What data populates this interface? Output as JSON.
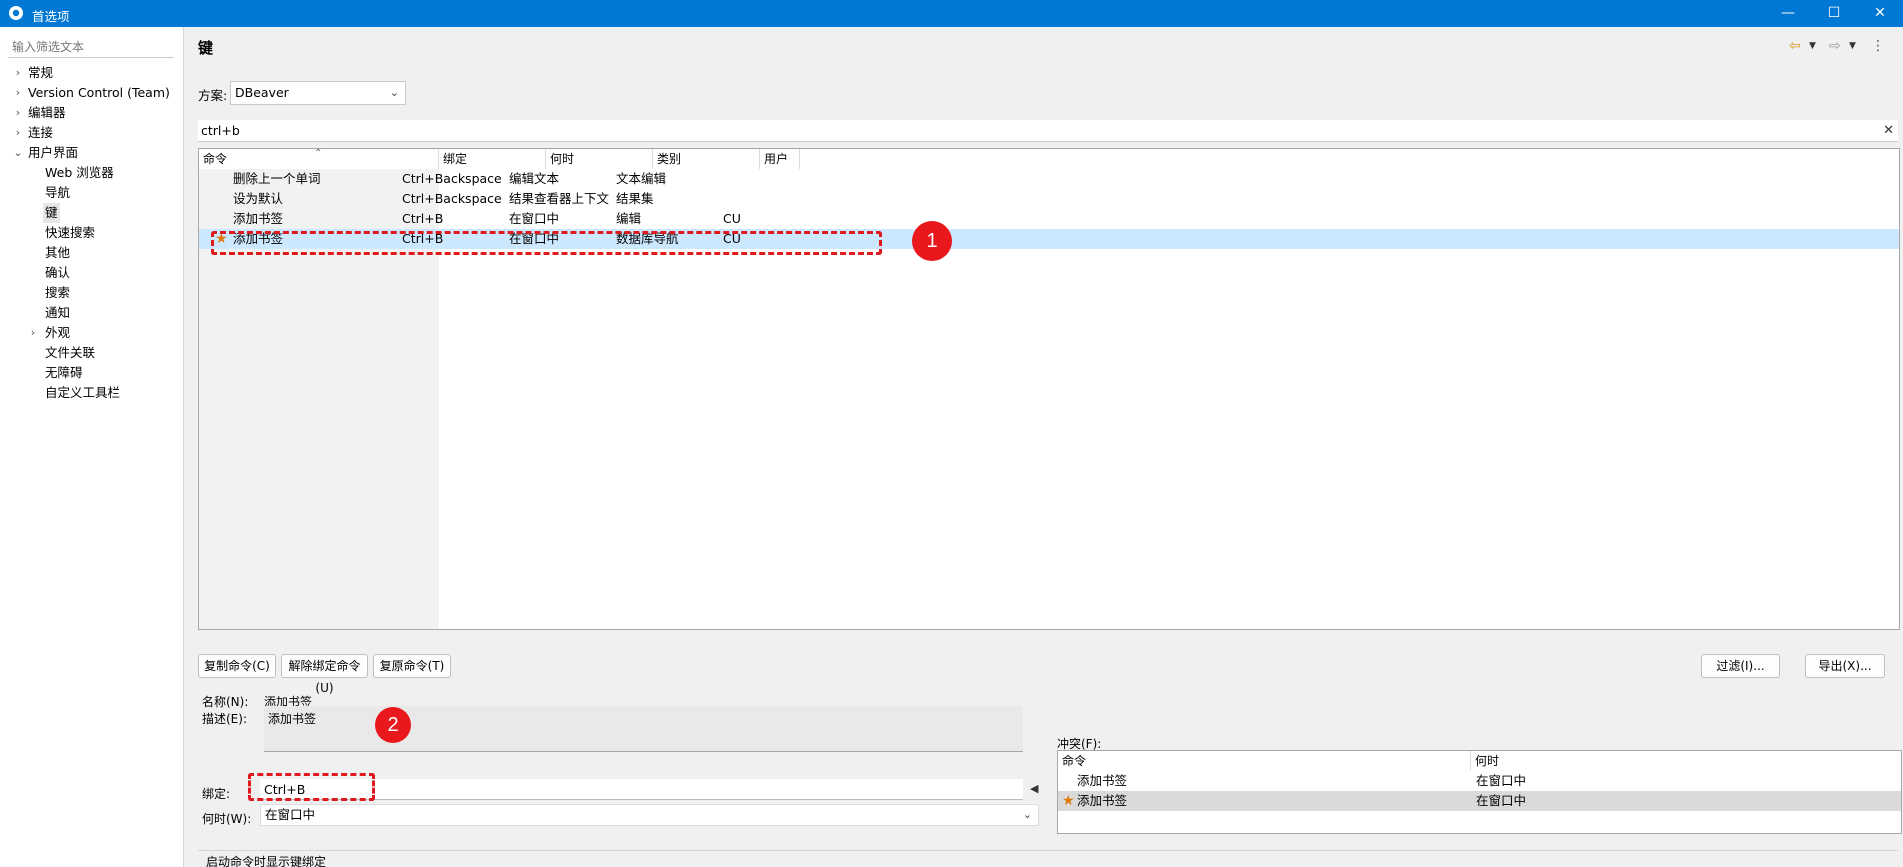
{
  "window": {
    "title": "首选项",
    "minimize_glyph": "—",
    "maximize_glyph": "☐",
    "close_glyph": "✕"
  },
  "sidebar": {
    "filter_placeholder": "输入筛选文本",
    "items": [
      {
        "label": "常规",
        "level": 0,
        "expander": "›"
      },
      {
        "label": "Version Control (Team)",
        "level": 0,
        "expander": "›"
      },
      {
        "label": "编辑器",
        "level": 0,
        "expander": "›"
      },
      {
        "label": "连接",
        "level": 0,
        "expander": "›"
      },
      {
        "label": "用户界面",
        "level": 0,
        "expander": "⌄"
      },
      {
        "label": "Web 浏览器",
        "level": 1,
        "expander": ""
      },
      {
        "label": "导航",
        "level": 1,
        "expander": ""
      },
      {
        "label": "键",
        "level": 1,
        "expander": "",
        "selected": true
      },
      {
        "label": "快速搜索",
        "level": 1,
        "expander": ""
      },
      {
        "label": "其他",
        "level": 1,
        "expander": ""
      },
      {
        "label": "确认",
        "level": 1,
        "expander": ""
      },
      {
        "label": "搜索",
        "level": 1,
        "expander": ""
      },
      {
        "label": "通知",
        "level": 1,
        "expander": ""
      },
      {
        "label": "外观",
        "level": 1,
        "expander": "›"
      },
      {
        "label": "文件关联",
        "level": 1,
        "expander": ""
      },
      {
        "label": "无障碍",
        "level": 1,
        "expander": ""
      },
      {
        "label": "自定义工具栏",
        "level": 1,
        "expander": ""
      }
    ]
  },
  "main": {
    "title": "键",
    "scheme_label": "方案:",
    "scheme_value": "DBeaver",
    "search_value": "ctrl+b",
    "table": {
      "columns": [
        "命令",
        "绑定",
        "何时",
        "类别",
        "用户"
      ],
      "rows": [
        {
          "star": "",
          "command": "删除上一个单词",
          "binding": "Ctrl+Backspace",
          "when": "编辑文本",
          "category": "文本编辑",
          "user": ""
        },
        {
          "star": "",
          "command": "设为默认",
          "binding": "Ctrl+Backspace",
          "when": "结果查看器上下文",
          "category": "结果集",
          "user": ""
        },
        {
          "star": "",
          "command": "添加书签",
          "binding": "Ctrl+B",
          "when": "在窗口中",
          "category": "编辑",
          "user": "CU"
        },
        {
          "star": "★",
          "command": "添加书签",
          "binding": "Ctrl+B",
          "when": "在窗口中",
          "category": "数据库导航",
          "user": "CU"
        }
      ]
    },
    "annotations": {
      "badge1": "1",
      "badge2": "2"
    },
    "buttons": {
      "copy": "复制命令(C)",
      "unbind": "解除绑定命令(U)",
      "restore": "复原命令(T)",
      "filter": "过滤(I)...",
      "export": "导出(X)..."
    },
    "details": {
      "name_label": "名称(N):",
      "name_value": "添加书签",
      "desc_label": "描述(E):",
      "desc_value": "添加书签",
      "binding_label": "绑定:",
      "binding_value": "Ctrl+B",
      "when_label": "何时(W):",
      "when_value": "在窗口中",
      "show_binding_label": "启动命令时显示键绑定"
    },
    "conflicts": {
      "label": "冲突(F):",
      "columns": [
        "命令",
        "何时"
      ],
      "rows": [
        {
          "star": "",
          "command": "添加书签",
          "when": "在窗口中"
        },
        {
          "star": "★",
          "command": "添加书签",
          "when": "在窗口中"
        }
      ]
    }
  },
  "colors": {
    "titlebar": "#0078d4",
    "selection": "#cce8ff",
    "annotation": "#e8181c",
    "star": "#e0780a"
  },
  "icons": [
    "app-gear-icon",
    "back-arrow-icon",
    "forward-arrow-icon",
    "view-menu-icon",
    "clear-search-icon",
    "star-icon",
    "dropdown-caret-icon"
  ]
}
